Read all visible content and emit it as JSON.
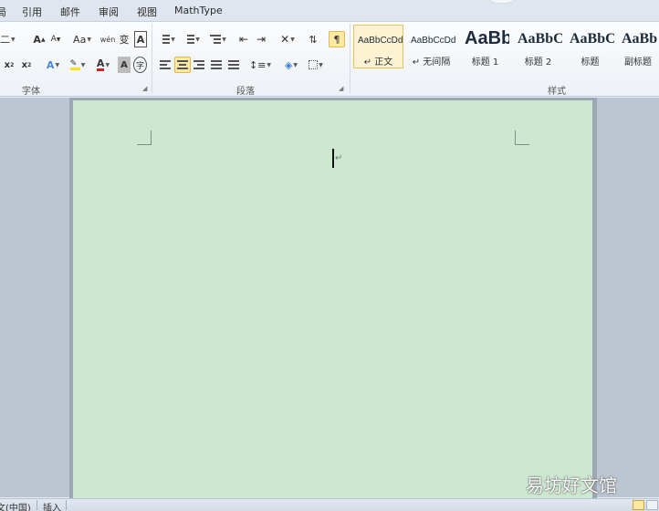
{
  "tabs": {
    "partial_left": "局",
    "references": "引用",
    "mailings": "邮件",
    "review": "审阅",
    "view": "视图",
    "mathtype": "MathType"
  },
  "font_group": {
    "label": "字体",
    "font_size_partial": "二",
    "grow_font": "A",
    "shrink_font": "A",
    "change_case": "Aa",
    "phonetic_guide": "wén",
    "enclose_char_label": "变",
    "char_border": "A",
    "subscript": "x",
    "superscript": "x",
    "text_effects": "A",
    "font_color": "A",
    "char_shading": "A",
    "enclose_circle": "字"
  },
  "paragraph_group": {
    "label": "段落"
  },
  "styles_group": {
    "label": "样式",
    "items": [
      {
        "sample": "AaBbCcDd",
        "name": "↵ 正文"
      },
      {
        "sample": "AaBbCcDd",
        "name": "↵ 无间隔"
      },
      {
        "sample": "AaBb",
        "name": "标题 1"
      },
      {
        "sample": "AaBbC",
        "name": "标题 2"
      },
      {
        "sample": "AaBbC",
        "name": "标题"
      },
      {
        "sample": "AaBb",
        "name": "副标题"
      }
    ]
  },
  "document": {
    "paragraph_mark": "↵",
    "background_color": "#cce8d0"
  },
  "status": {
    "language": "文(中国)",
    "insert_mode": "插入"
  },
  "watermark": "易坊好文馆",
  "colors": {
    "ribbon_bg": "#f3f6f9",
    "selected_highlight": "#fde8a4",
    "doc_area": "#bcc6d3"
  }
}
